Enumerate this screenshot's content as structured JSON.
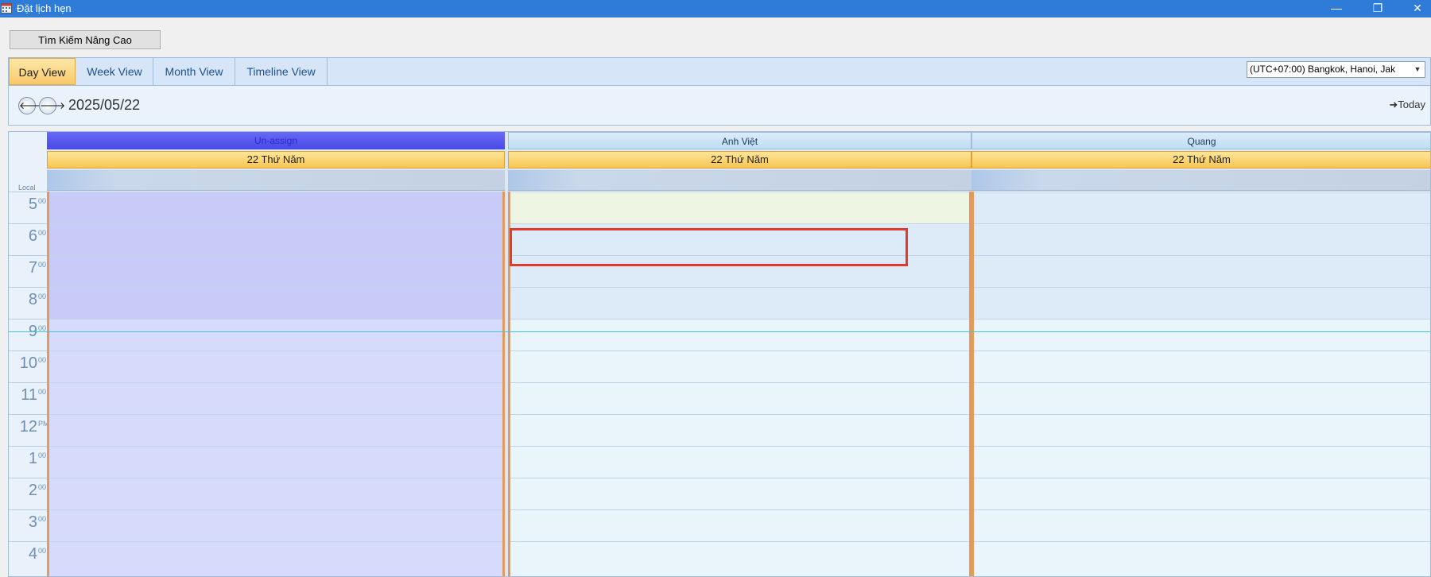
{
  "window": {
    "title": "Đặt lịch hẹn",
    "minimize": "—",
    "restore": "❐",
    "close": "✕"
  },
  "toolbar": {
    "search_label": "Tìm Kiếm Nâng Cao"
  },
  "tabs": [
    {
      "label": "Day View",
      "active": true
    },
    {
      "label": "Week View",
      "active": false
    },
    {
      "label": "Month View",
      "active": false
    },
    {
      "label": "Timeline View",
      "active": false
    }
  ],
  "timezone": {
    "value": "(UTC+07:00) Bangkok, Hanoi, Jak"
  },
  "navigation": {
    "prev": "🡐",
    "next": "🡒",
    "date": "2025/05/22",
    "today": "➜Today"
  },
  "calendar": {
    "local_label": "Local",
    "hours": [
      {
        "hour": "5",
        "suffix": "00"
      },
      {
        "hour": "6",
        "suffix": "00"
      },
      {
        "hour": "7",
        "suffix": "00"
      },
      {
        "hour": "8",
        "suffix": "00"
      },
      {
        "hour": "9",
        "suffix": "00"
      },
      {
        "hour": "10",
        "suffix": "00"
      },
      {
        "hour": "11",
        "suffix": "00"
      },
      {
        "hour": "12",
        "suffix": "PM"
      },
      {
        "hour": "1",
        "suffix": "00"
      },
      {
        "hour": "2",
        "suffix": "00"
      },
      {
        "hour": "3",
        "suffix": "00"
      },
      {
        "hour": "4",
        "suffix": "00"
      }
    ],
    "resources": [
      {
        "name": "Un-assign",
        "day": "22 Thứ Năm"
      },
      {
        "name": "Anh Việt",
        "day": "22 Thứ Năm"
      },
      {
        "name": "Quang",
        "day": "22 Thứ Năm"
      }
    ]
  },
  "colors": {
    "titlebar": "#2f7bd8",
    "unassign_header": "#5555ee",
    "unassign_work": "#c8cbf8",
    "unassign_off": "#d6dbfb",
    "resource_header": "#cfe6f8",
    "work_hours": "#dcebf7",
    "off_hours": "#eaf4fb",
    "early_slot": "#eef5e2",
    "selection": "#e53a2a"
  }
}
